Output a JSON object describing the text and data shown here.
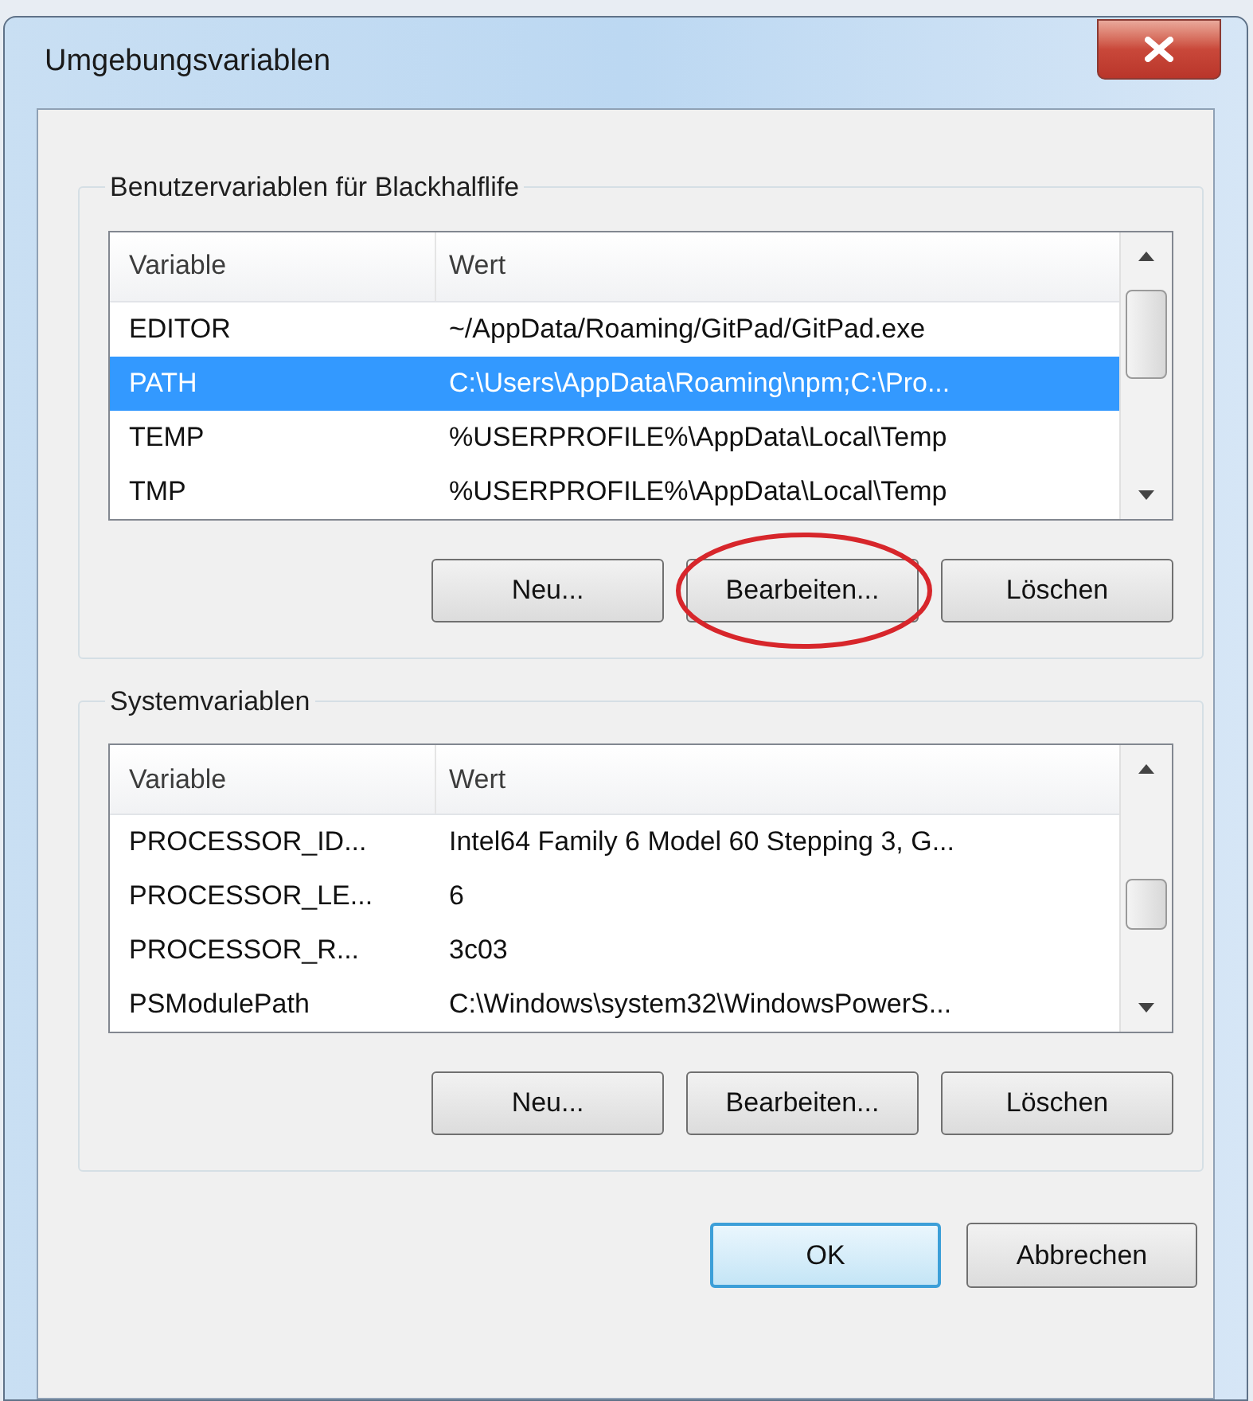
{
  "window": {
    "title": "Umgebungsvariablen"
  },
  "groups": [
    {
      "title": "Benutzervariablen für Blackhalflife",
      "columns": [
        "Variable",
        "Wert"
      ],
      "rows": [
        {
          "variable": "EDITOR",
          "value": "~/AppData/Roaming/GitPad/GitPad.exe",
          "selected": false
        },
        {
          "variable": "PATH",
          "value": "C:\\Users\\AppData\\Roaming\\npm;C:\\Pro...",
          "selected": true
        },
        {
          "variable": "TEMP",
          "value": "%USERPROFILE%\\AppData\\Local\\Temp",
          "selected": false
        },
        {
          "variable": "TMP",
          "value": "%USERPROFILE%\\AppData\\Local\\Temp",
          "selected": false
        }
      ],
      "buttons": [
        {
          "label": "Neu...",
          "circled": false
        },
        {
          "label": "Bearbeiten...",
          "circled": true
        },
        {
          "label": "Löschen",
          "circled": false
        }
      ]
    },
    {
      "title": "Systemvariablen",
      "columns": [
        "Variable",
        "Wert"
      ],
      "rows": [
        {
          "variable": "PROCESSOR_ID...",
          "value": "Intel64 Family 6 Model 60 Stepping 3, G...",
          "selected": false
        },
        {
          "variable": "PROCESSOR_LE...",
          "value": "6",
          "selected": false
        },
        {
          "variable": "PROCESSOR_R...",
          "value": "3c03",
          "selected": false
        },
        {
          "variable": "PSModulePath",
          "value": "C:\\Windows\\system32\\WindowsPowerS...",
          "selected": false
        }
      ],
      "buttons": [
        {
          "label": "Neu...",
          "circled": false
        },
        {
          "label": "Bearbeiten...",
          "circled": false
        },
        {
          "label": "Löschen",
          "circled": false
        }
      ]
    }
  ],
  "footer_buttons": [
    {
      "label": "OK",
      "default": true
    },
    {
      "label": "Abbrechen",
      "default": false
    }
  ]
}
